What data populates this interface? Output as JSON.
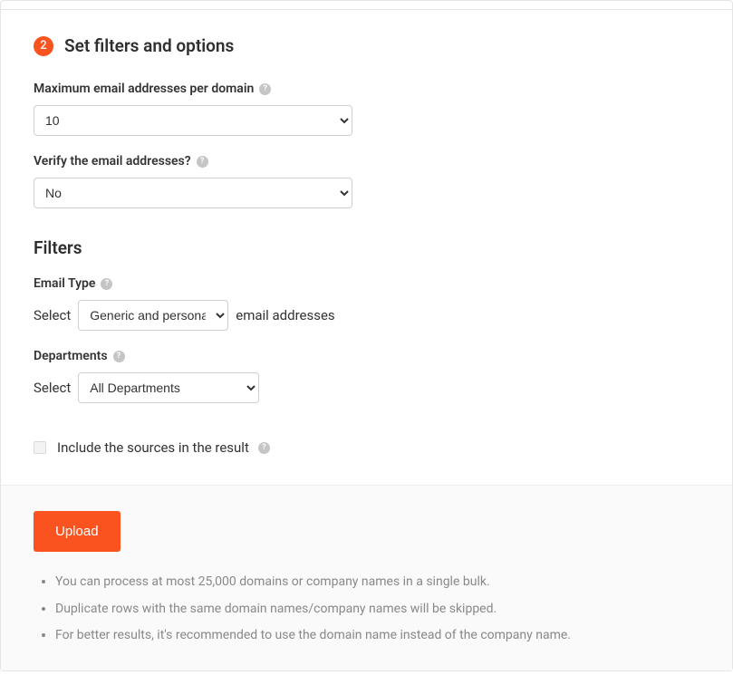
{
  "step": {
    "number": "2",
    "title": "Set filters and options"
  },
  "maxEmails": {
    "label": "Maximum email addresses per domain",
    "value": "10"
  },
  "verify": {
    "label": "Verify the email addresses?",
    "value": "No"
  },
  "filters": {
    "title": "Filters"
  },
  "emailType": {
    "label": "Email Type",
    "prefix": "Select",
    "value": "Generic and personal",
    "suffix": "email addresses"
  },
  "departments": {
    "label": "Departments",
    "prefix": "Select",
    "value": "All Departments"
  },
  "includeSources": {
    "label": "Include the sources in the result"
  },
  "upload": {
    "button": "Upload",
    "notes": [
      "You can process at most 25,000 domains or company names in a single bulk.",
      "Duplicate rows with the same domain names/company names will be skipped.",
      "For better results, it's recommended to use the domain name instead of the company name."
    ]
  }
}
